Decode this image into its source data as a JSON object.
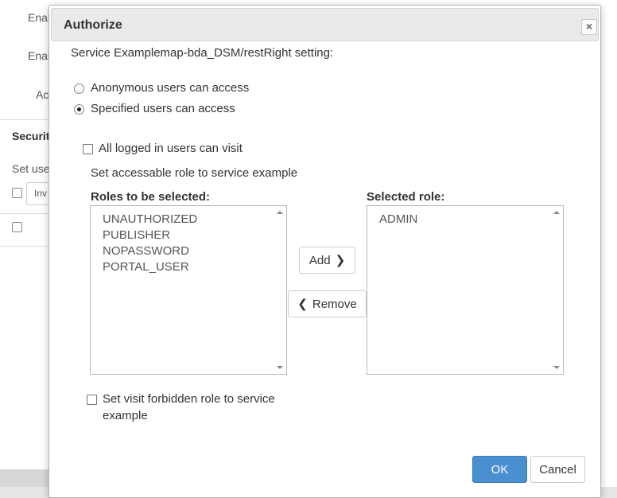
{
  "background": {
    "labels": [
      "Enal",
      "Enal",
      "Ac",
      "Securit",
      "Set use",
      "Inv"
    ]
  },
  "dialog": {
    "title": "Authorize",
    "close_symbol": "×",
    "service_setting_text": "Service Examplemap-bda_DSM/restRight setting:",
    "radio_anonymous": "Anonymous users can access",
    "radio_specified": "Specified users can access",
    "selected_radio": "specified",
    "check_all_logged": "All logged in users can visit",
    "set_role_text": "Set accessable role to service example",
    "roles_label": "Roles to be selected:",
    "roles_items": [
      "UNAUTHORIZED",
      "PUBLISHER",
      "NOPASSWORD",
      "PORTAL_USER"
    ],
    "selected_label": "Selected role:",
    "selected_items": [
      "ADMIN"
    ],
    "add_button": "Add",
    "remove_button": "Remove",
    "forbidden_line1": "Set visit forbidden role to service",
    "forbidden_line2": "example",
    "ok_button": "OK",
    "cancel_button": "Cancel",
    "colors": {
      "primary": "#4a8fcf",
      "titlebar": "#eaeaea"
    }
  }
}
